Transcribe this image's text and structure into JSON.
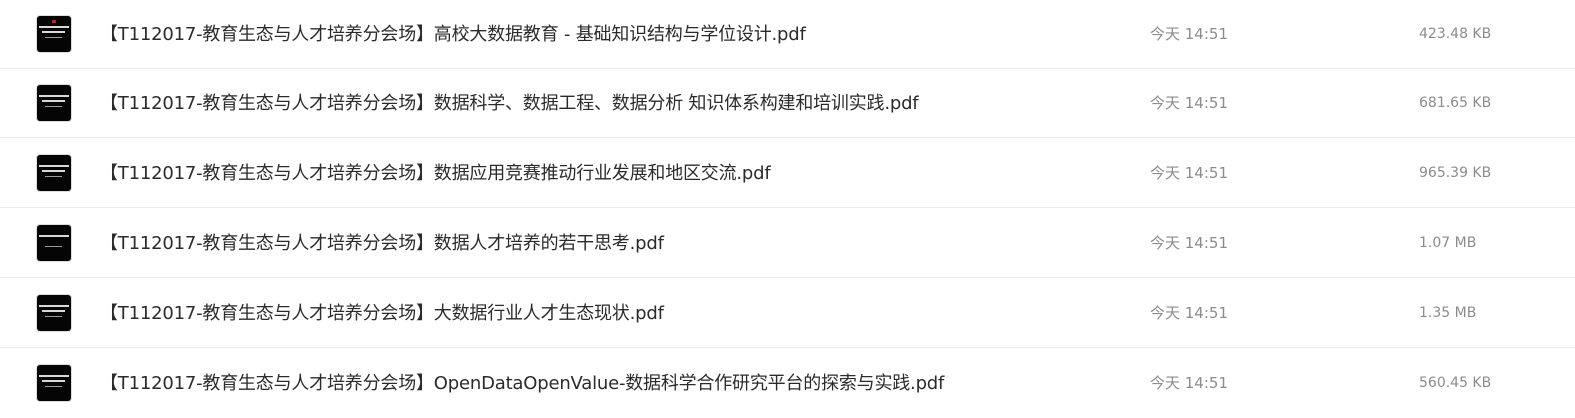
{
  "files": [
    {
      "thumbnail_icon": "pdf-thumbnail-icon",
      "name": "【T112017-教育生态与人才培养分会场】高校大数据教育 - 基础知识结构与学位设计.pdf",
      "modified": "今天 14:51",
      "size": "423.48 KB"
    },
    {
      "thumbnail_icon": "pdf-thumbnail-icon",
      "name": "【T112017-教育生态与人才培养分会场】数据科学、数据工程、数据分析 知识体系构建和培训实践.pdf",
      "modified": "今天 14:51",
      "size": "681.65 KB"
    },
    {
      "thumbnail_icon": "pdf-thumbnail-icon",
      "name": "【T112017-教育生态与人才培养分会场】数据应用竞赛推动行业发展和地区交流.pdf",
      "modified": "今天 14:51",
      "size": "965.39 KB"
    },
    {
      "thumbnail_icon": "pdf-thumbnail-icon",
      "name": "【T112017-教育生态与人才培养分会场】数据人才培养的若干思考.pdf",
      "modified": "今天 14:51",
      "size": "1.07 MB"
    },
    {
      "thumbnail_icon": "pdf-thumbnail-icon",
      "name": "【T112017-教育生态与人才培养分会场】大数据行业人才生态现状.pdf",
      "modified": "今天 14:51",
      "size": "1.35 MB"
    },
    {
      "thumbnail_icon": "pdf-thumbnail-icon",
      "name": "【T112017-教育生态与人才培养分会场】OpenDataOpenValue-数据科学合作研究平台的探索与实践.pdf",
      "modified": "今天 14:51",
      "size": "560.45 KB"
    }
  ],
  "colors": {
    "filename_text": "#2b2b2b",
    "meta_text": "#8c8c8c",
    "row_divider": "#ececec",
    "thumbnail_bg": "#050505"
  }
}
